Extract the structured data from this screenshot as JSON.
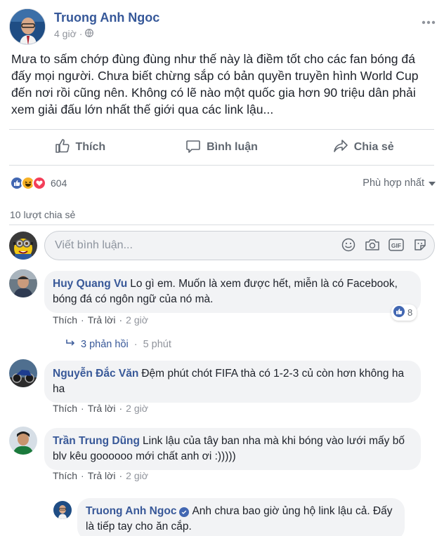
{
  "post": {
    "author": "Truong Anh Ngoc",
    "time": "4 giờ",
    "separator": "·",
    "text": "Mưa to sấm chớp đùng đùng như thế này là điềm tốt cho các fan bóng đá đấy mọi người. Chưa biết chừng sắp có bản quyền truyền hình World Cup đến nơi rồi cũng nên. Không có lẽ nào một quốc gia hơn 90 triệu dân phải xem giải đấu lớn nhất thế giới qua các link lậu...",
    "actions": {
      "like": "Thích",
      "comment": "Bình luận",
      "share": "Chia sẻ"
    },
    "reactions": {
      "count": "604",
      "types": [
        "like",
        "haha",
        "love"
      ]
    },
    "sort_label": "Phù hợp nhất",
    "shares": "10 lượt chia sẻ"
  },
  "composer": {
    "placeholder": "Viết bình luận..."
  },
  "comments": [
    {
      "author": "Huy Quang Vu",
      "text": "Lo gì em. Muốn là xem được hết, miễn là có Facebook, bóng đá có ngôn ngữ của nó mà.",
      "like": "Thích",
      "reply": "Trả lời",
      "time": "2 giờ",
      "likes": "8",
      "replies": "3 phản hồi",
      "replies_time": "5 phút"
    },
    {
      "author": "Nguyễn Đắc Văn",
      "text": "Đệm phút chót FIFA thà có 1-2-3 củ còn hơn không ha ha",
      "like": "Thích",
      "reply": "Trả lời",
      "time": "2 giờ"
    },
    {
      "author": "Trần Trung Dũng",
      "text": "Link lậu của tây ban nha mà khi bóng vào lưới mấy bố blv kêu goooooo mới chất anh ơi :)))))",
      "like": "Thích",
      "reply": "Trả lời",
      "time": "2 giờ"
    },
    {
      "author": "Truong Anh Ngoc",
      "text": "Anh chưa bao giờ ủng hộ link lậu cả. Đấy là tiếp tay cho ăn cắp."
    }
  ],
  "colors": {
    "link": "#385898",
    "brand": "#4267b2",
    "love": "#f33e58",
    "haha": "#f7b125"
  }
}
